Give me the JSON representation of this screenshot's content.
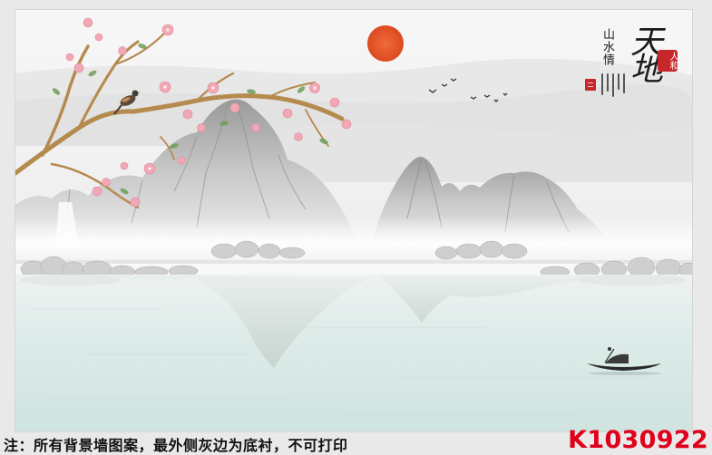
{
  "caption_note": "注：所有背景墙图案，最外侧灰边为底衬，不可打印",
  "product_code": "K1030922",
  "calligraphy": {
    "small_vertical": "山水情",
    "large": "天地",
    "seal_text": "人和"
  },
  "colors": {
    "page_border": "#e9e9e9",
    "sun": "#e6572c",
    "code_red": "#e0001b",
    "seal_red": "#c7262b",
    "water": "#d8e8e6",
    "blossom": "#f0a9b4"
  }
}
